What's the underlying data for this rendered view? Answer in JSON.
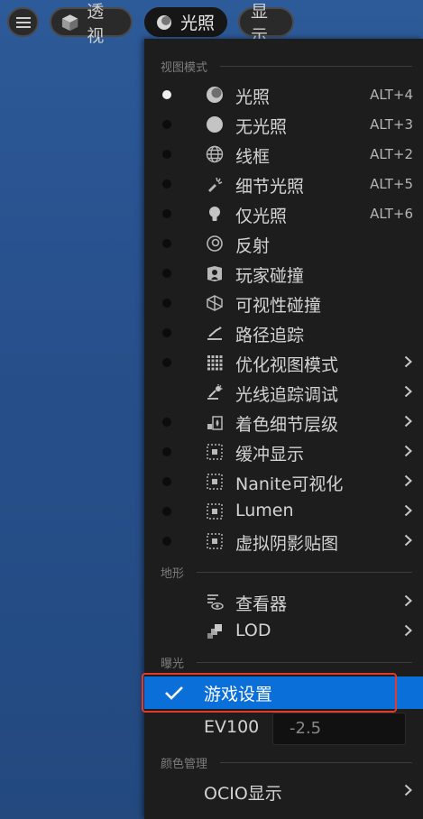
{
  "toolbar": {
    "perspective_label": "透视",
    "lighting_label": "光照",
    "show_label": "显示"
  },
  "menu": {
    "sections": {
      "view_mode": "视图模式",
      "landscape": "地形",
      "exposure": "曝光",
      "color_management": "颜色管理"
    },
    "view_modes": [
      {
        "label": "光照",
        "shortcut": "ALT+4",
        "icon": "lit-sphere-icon",
        "active": true
      },
      {
        "label": "无光照",
        "shortcut": "ALT+3",
        "icon": "unlit-sphere-icon"
      },
      {
        "label": "线框",
        "shortcut": "ALT+2",
        "icon": "wireframe-globe-icon"
      },
      {
        "label": "细节光照",
        "shortcut": "ALT+5",
        "icon": "detail-lighting-icon"
      },
      {
        "label": "仅光照",
        "shortcut": "ALT+6",
        "icon": "lightbulb-icon"
      },
      {
        "label": "反射",
        "icon": "reflection-icon"
      },
      {
        "label": "玩家碰撞",
        "icon": "player-collision-icon"
      },
      {
        "label": "可视性碰撞",
        "icon": "visibility-collision-icon"
      },
      {
        "label": "路径追踪",
        "icon": "path-tracing-icon"
      },
      {
        "label": "优化视图模式",
        "icon": "grid-icon",
        "submenu": true
      },
      {
        "label": "光线追踪调试",
        "icon": "ray-tracing-debug-icon",
        "submenu": true
      },
      {
        "label": "着色细节层级",
        "icon": "shading-lod-icon",
        "submenu": true
      },
      {
        "label": "缓冲显示",
        "icon": "buffer-icon",
        "submenu": true
      },
      {
        "label": "Nanite可视化",
        "icon": "nanite-icon",
        "submenu": true
      },
      {
        "label": "Lumen",
        "icon": "lumen-icon",
        "submenu": true
      },
      {
        "label": "虚拟阴影贴图",
        "icon": "virtual-shadow-map-icon",
        "submenu": true
      }
    ],
    "landscape_items": [
      {
        "label": "查看器",
        "icon": "viewer-icon",
        "submenu": true
      },
      {
        "label": "LOD",
        "icon": "lod-icon",
        "submenu": true
      }
    ],
    "game_settings_label": "游戏设置",
    "ev100_label": "EV100",
    "ev100_value": "-2.5",
    "ocio_label": "OCIO显示",
    "accent_color": "#0a6fd8",
    "annotation_color": "#e23a2c"
  }
}
